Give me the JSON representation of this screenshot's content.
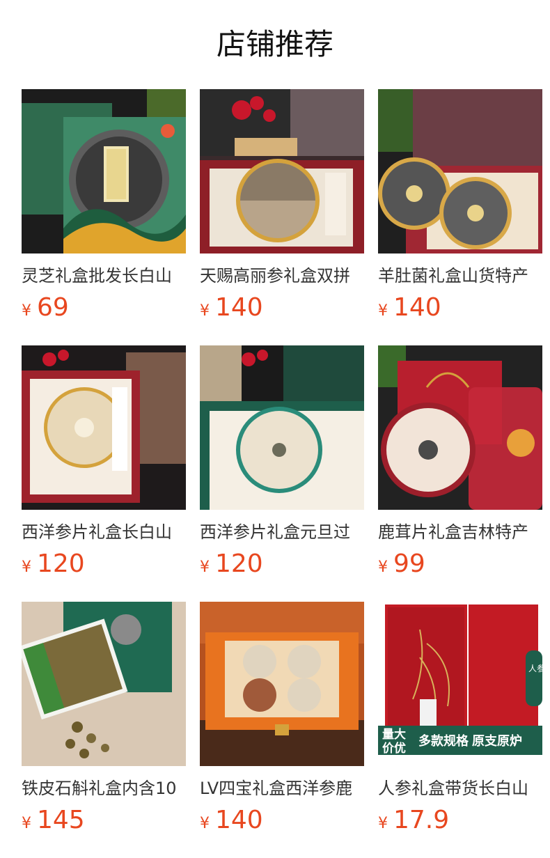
{
  "section": {
    "title": "店铺推荐"
  },
  "products": [
    {
      "name": "灵芝礼盒批发长白山",
      "currency": "¥",
      "price": "69",
      "image": "lingzhi-giftbox-image",
      "colors": {
        "bg": "#2f6b4e",
        "accent": "#4a4a4a",
        "box": "#3f8a68"
      }
    },
    {
      "name": "天赐高丽参礼盒双拼",
      "currency": "¥",
      "price": "140",
      "image": "korean-ginseng-giftbox-image",
      "colors": {
        "bg": "#3b3034",
        "accent": "#b8a48a",
        "box": "#8e1f27"
      }
    },
    {
      "name": "羊肚菌礼盒山货特产",
      "currency": "¥",
      "price": "140",
      "image": "morel-mushroom-giftbox-image",
      "colors": {
        "bg": "#6b3e45",
        "accent": "#555",
        "box": "#a02733"
      }
    },
    {
      "name": "西洋参片礼盒长白山",
      "currency": "¥",
      "price": "120",
      "image": "american-ginseng-slices-giftbox-image",
      "colors": {
        "bg": "#2a2326",
        "accent": "#e8d8b8",
        "box": "#9e222c"
      }
    },
    {
      "name": "西洋参片礼盒元旦过",
      "currency": "¥",
      "price": "120",
      "image": "american-ginseng-newyear-giftbox-image",
      "colors": {
        "bg": "#1f4a3c",
        "accent": "#ece2cf",
        "box": "#1e5e4b"
      }
    },
    {
      "name": "鹿茸片礼盒吉林特产",
      "currency": "¥",
      "price": "99",
      "image": "deer-antler-giftbox-image",
      "colors": {
        "bg": "#b81f2e",
        "accent": "#f2e4d8",
        "box": "#c4283a"
      }
    },
    {
      "name": "铁皮石斛礼盒内含10",
      "currency": "¥",
      "price": "145",
      "image": "dendrobium-giftbox-image",
      "colors": {
        "bg": "#d9c8b4",
        "accent": "#7b6a3a",
        "box": "#1f6a52"
      }
    },
    {
      "name": "LV四宝礼盒西洋参鹿",
      "currency": "¥",
      "price": "140",
      "image": "four-treasures-giftbox-image",
      "colors": {
        "bg": "#b5511f",
        "accent": "#e0d4bf",
        "box": "#e8731f"
      }
    },
    {
      "name": "人参礼盒带货长白山",
      "currency": "¥",
      "price": "17.9",
      "image": "ginseng-giftbox-image",
      "colors": {
        "bg": "#ffffff",
        "accent": "#d8b25a",
        "box": "#c31b24"
      }
    }
  ],
  "badges": {
    "volume_label": "量大\n价优",
    "spec_label": "多款规格 原支原炉",
    "side_label": "人参+礼盒"
  }
}
